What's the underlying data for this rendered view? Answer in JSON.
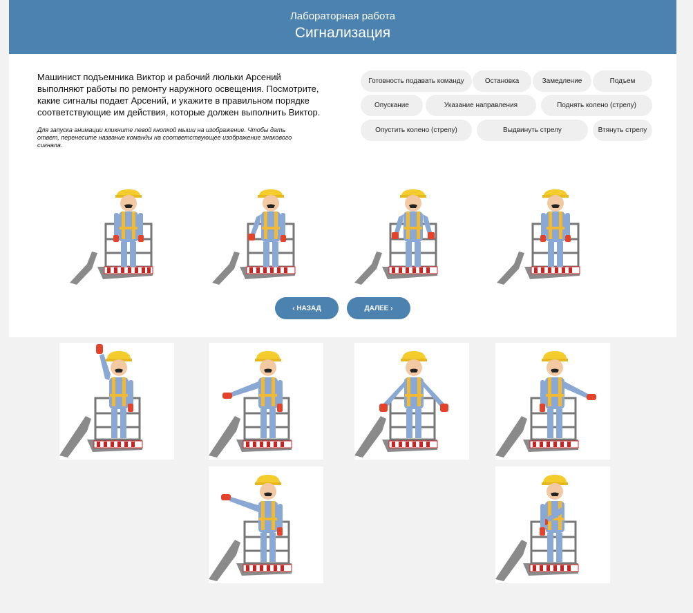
{
  "header": {
    "subtitle": "Лабораторная работа",
    "title": "Сигнализация"
  },
  "instructions": {
    "text": "Машинист подъемника Виктор и рабочий люльки Арсений выполняют работы по ремонту наружного освещения. Посмотрите, какие сигналы подает Арсений, и укажите в правильном порядке соответствующие им действия, которые должен выполнить Виктор.",
    "hint": "Для запуска анимации кликните левой кнопкой мыши на изображение. Чтобы дать ответ, перенесите название команды на соответствующее изображение знакового сигнала."
  },
  "commands": [
    "Готовность подавать команду",
    "Остановка",
    "Замедление",
    "Подъем",
    "Опускание",
    "Указание направления",
    "Поднять колено (стрелу)",
    "Опустить колено (стрелу)",
    "Выдвинуть стрелу",
    "Втянуть стрелу"
  ],
  "nav": {
    "back": "‹ НАЗАД",
    "next": "ДАЛЕЕ ›"
  },
  "colors": {
    "header": "#4b82b0",
    "button": "#4b82b0",
    "chip_bg": "#efefef",
    "helmet": "#f4cc2c",
    "overall": "#8aa8d4",
    "glove": "#e4432b",
    "harness": "#f2b933",
    "lift": "#8a8a8a"
  }
}
